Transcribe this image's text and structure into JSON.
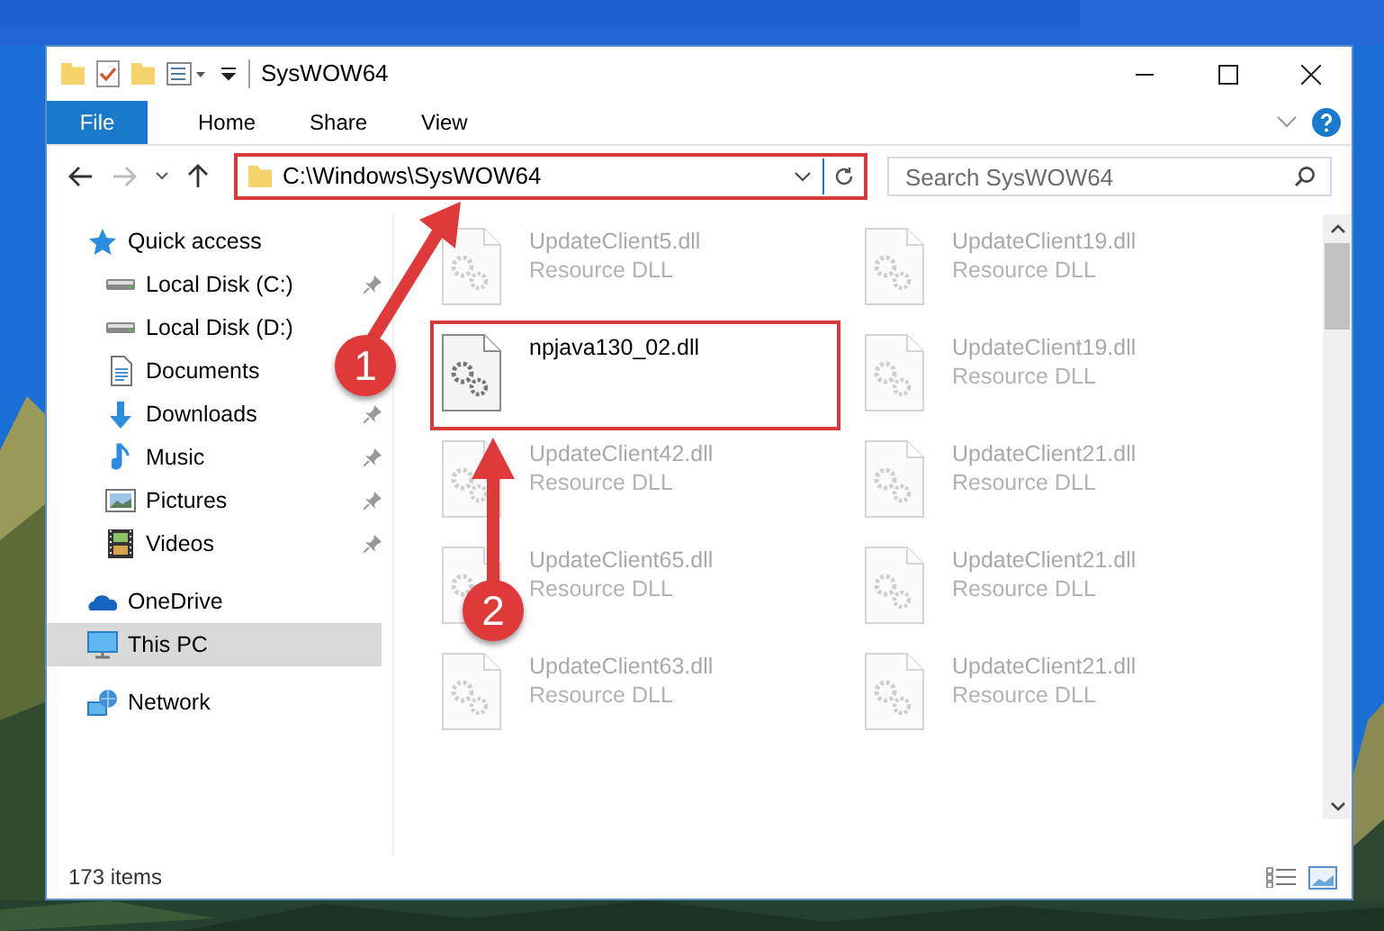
{
  "window": {
    "title": "SysWOW64"
  },
  "ribbon": {
    "file_tab": "File",
    "tabs": [
      "Home",
      "Share",
      "View"
    ]
  },
  "address": {
    "path": "C:\\Windows\\SysWOW64",
    "highlighted": true
  },
  "search": {
    "placeholder": "Search SysWOW64"
  },
  "nav": [
    {
      "label": "Quick access",
      "selected": false,
      "children": [
        {
          "label": "Local Disk (C:)",
          "pinned": true,
          "selected": false
        },
        {
          "label": "Local Disk (D:)",
          "pinned": false,
          "selected": false
        },
        {
          "label": "Documents",
          "pinned": false,
          "selected": false
        },
        {
          "label": "Downloads",
          "pinned": true,
          "selected": false
        },
        {
          "label": "Music",
          "pinned": true,
          "selected": false
        },
        {
          "label": "Pictures",
          "pinned": true,
          "selected": false
        },
        {
          "label": "Videos",
          "pinned": true,
          "selected": false
        }
      ]
    },
    {
      "label": "OneDrive",
      "selected": false
    },
    {
      "label": "This PC",
      "selected": true
    },
    {
      "label": "Network",
      "selected": false
    }
  ],
  "files": [
    {
      "name": "UpdateClient5.dll",
      "type": "Resource DLL",
      "faded": true,
      "highlighted": false
    },
    {
      "name": "UpdateClient19.dll",
      "type": "Resource DLL",
      "faded": true,
      "highlighted": false
    },
    {
      "name": "npjava130_02.dll",
      "faded": false,
      "highlighted": true
    },
    {
      "name": "UpdateClient19.dll",
      "type": "Resource DLL",
      "faded": true,
      "highlighted": false
    },
    {
      "name": "UpdateClient42.dll",
      "type": "Resource DLL",
      "faded": true,
      "highlighted": false
    },
    {
      "name": "UpdateClient21.dll",
      "type": "Resource DLL",
      "faded": true,
      "highlighted": false
    },
    {
      "name": "UpdateClient65.dll",
      "type": "Resource DLL",
      "faded": true,
      "highlighted": false
    },
    {
      "name": "UpdateClient21.dll",
      "type": "Resource DLL",
      "faded": true,
      "highlighted": false
    },
    {
      "name": "UpdateClient63.dll",
      "type": "Resource DLL",
      "faded": true,
      "highlighted": false
    },
    {
      "name": "UpdateClient21.dll",
      "type": "Resource DLL",
      "faded": true,
      "highlighted": false
    }
  ],
  "annotations": [
    {
      "label": "1"
    },
    {
      "label": "2"
    }
  ],
  "status_bar": {
    "count": "173 items"
  }
}
